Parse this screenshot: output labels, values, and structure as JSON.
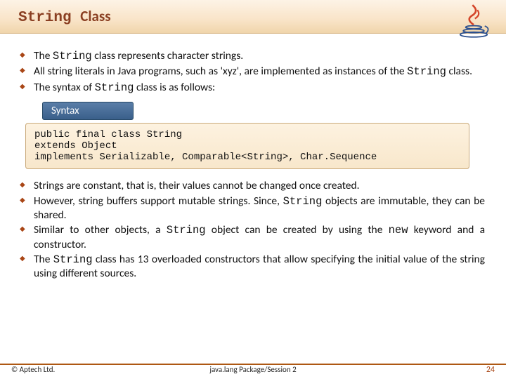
{
  "header": {
    "title_part1": "String",
    "title_part2": "Class"
  },
  "bullets_top": [
    {
      "pre": "The ",
      "mono": "String",
      "post": " class represents character strings."
    },
    {
      "pre": "All string literals in Java programs, such as 'xyz', are implemented as instances of the ",
      "mono": "String",
      "post": " class."
    },
    {
      "pre": "The syntax of ",
      "mono": "String",
      "post": " class is as follows:"
    }
  ],
  "syntax_label": "Syntax",
  "code": "public final class String\nextends Object\nimplements Serializable, Comparable<String>, Char.Sequence",
  "bullets_bottom": [
    {
      "text": "Strings are constant, that is, their values cannot be changed once created."
    },
    {
      "pre": "However, string buffers support mutable strings. Since, ",
      "mono": "String",
      "post": " objects are immutable, they can be shared."
    },
    {
      "pre": "Similar to other objects, a ",
      "mono": "String",
      "post": " object can be created by using the ",
      "mono2": "new",
      "post2": " keyword and a constructor."
    },
    {
      "pre": "The ",
      "mono": "String",
      "post": " class has 13 overloaded constructors that allow specifying the initial value of the string using different sources."
    }
  ],
  "footer": {
    "left": "© Aptech Ltd.",
    "center": "java.lang Package/Session 2",
    "right": "24"
  }
}
